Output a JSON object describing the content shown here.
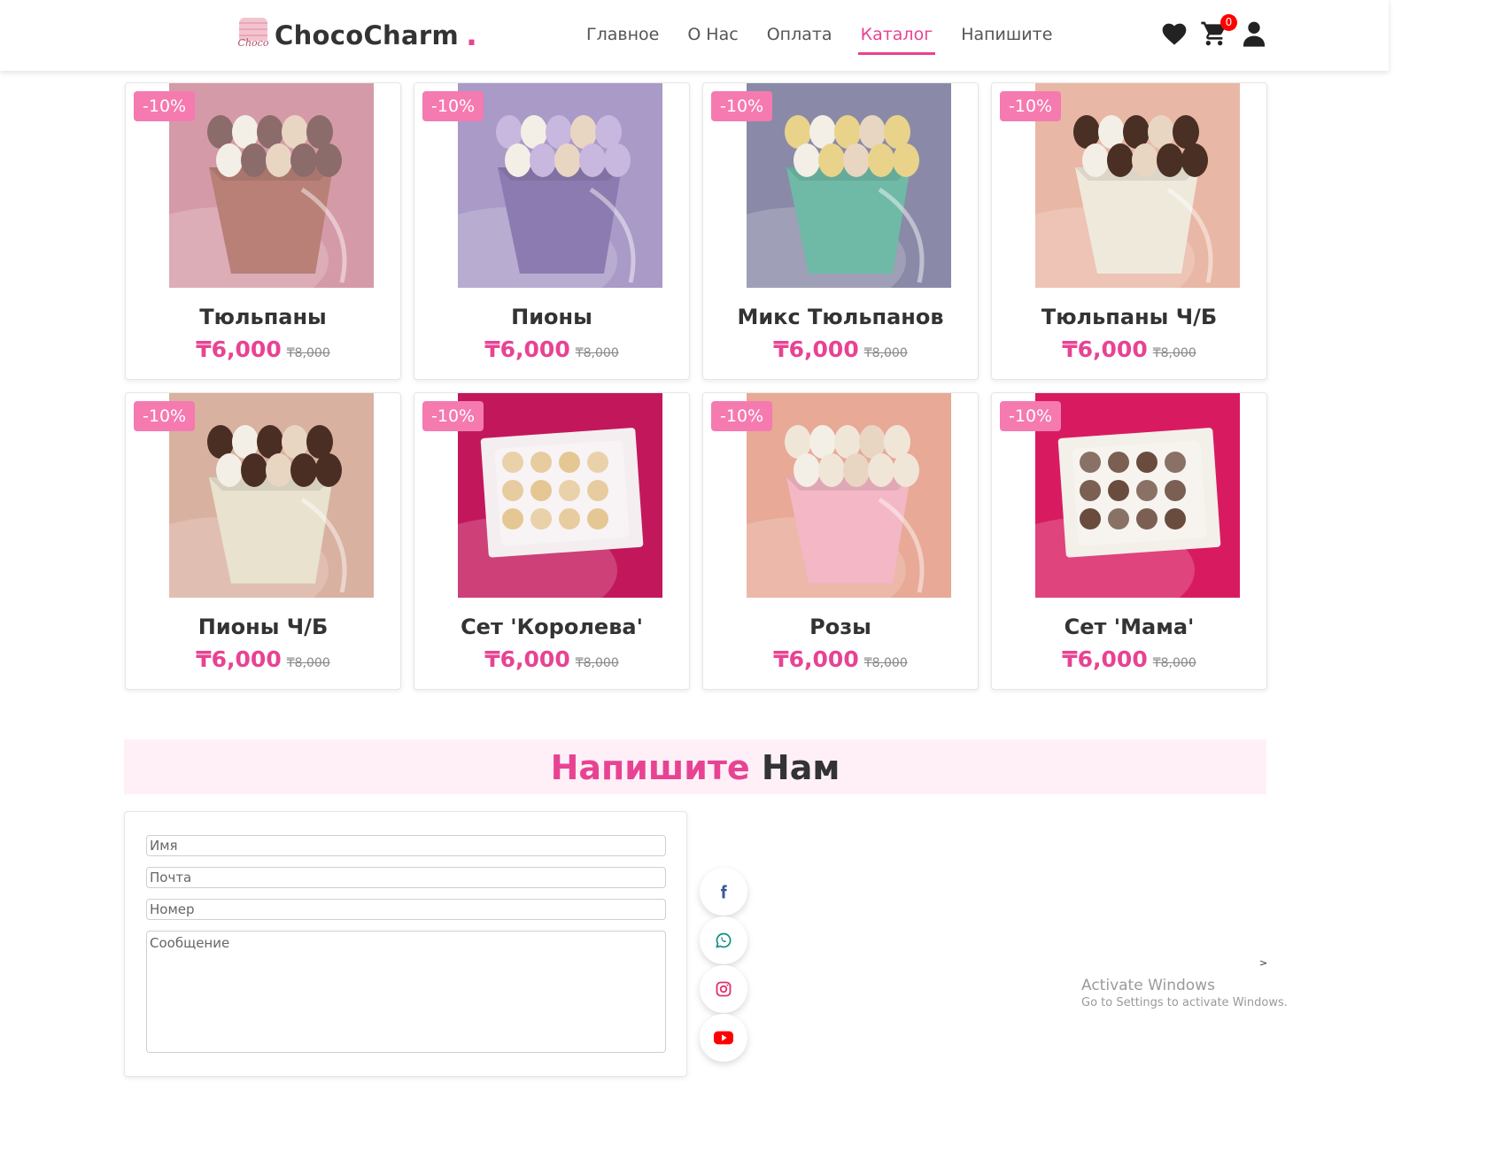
{
  "brand": {
    "name": "ChocoCharm",
    "dot": ".",
    "logo_script": "Choco",
    "accent": "#e84393"
  },
  "nav": [
    {
      "label": "Главное",
      "active": false
    },
    {
      "label": "О Нас",
      "active": false
    },
    {
      "label": "Оплата",
      "active": false
    },
    {
      "label": "Каталог",
      "active": true
    },
    {
      "label": "Напишите",
      "active": false
    }
  ],
  "header_icons": {
    "wishlist": "heart-icon",
    "cart": "cart-icon",
    "cart_count": "0",
    "account": "user-icon"
  },
  "products": [
    {
      "name": "Тюльпаны",
      "discount": "-10%",
      "price": "₸6,000",
      "old_price": "₸8,000",
      "palette": [
        "#d59aa8",
        "#b88077",
        "#8c6b6b"
      ]
    },
    {
      "name": "Пионы",
      "discount": "-10%",
      "price": "₸6,000",
      "old_price": "₸8,000",
      "palette": [
        "#a99ac7",
        "#8c7bb0",
        "#c8b8e0"
      ]
    },
    {
      "name": "Микс Тюльпанов",
      "discount": "-10%",
      "price": "₸6,000",
      "old_price": "₸8,000",
      "palette": [
        "#8a8aa8",
        "#6fb9a7",
        "#e9d38a"
      ]
    },
    {
      "name": "Тюльпаны Ч/Б",
      "discount": "-10%",
      "price": "₸6,000",
      "old_price": "₸8,000",
      "palette": [
        "#e9b7a5",
        "#efe9dc",
        "#4a2f25"
      ]
    },
    {
      "name": "Пионы Ч/Б",
      "discount": "-10%",
      "price": "₸6,000",
      "old_price": "₸8,000",
      "palette": [
        "#d9b1a1",
        "#e8e2cf",
        "#4b2e23"
      ]
    },
    {
      "name": "Сет 'Королева'",
      "discount": "-10%",
      "price": "₸6,000",
      "old_price": "₸8,000",
      "palette": [
        "#c2185b",
        "#f4eef0",
        "#e2c28a"
      ]
    },
    {
      "name": "Розы",
      "discount": "-10%",
      "price": "₸6,000",
      "old_price": "₸8,000",
      "palette": [
        "#e8a996",
        "#f3b7c5",
        "#f0e6d8"
      ]
    },
    {
      "name": "Сет 'Мама'",
      "discount": "-10%",
      "price": "₸6,000",
      "old_price": "₸8,000",
      "palette": [
        "#d81b60",
        "#f3efe9",
        "#5a3a2a"
      ]
    }
  ],
  "contact": {
    "heading_accent": "Напишите",
    "heading_rest": "Нам",
    "name_placeholder": "Имя",
    "email_placeholder": "Почта",
    "phone_placeholder": "Номер",
    "message_placeholder": "Сообщение"
  },
  "social": [
    {
      "icon": "facebook-icon",
      "color": "#3b5998"
    },
    {
      "icon": "whatsapp-icon",
      "color": "#128c7e"
    },
    {
      "icon": "instagram-icon",
      "color": "#e1306c"
    },
    {
      "icon": "youtube-icon",
      "color": "#ff0000"
    }
  ],
  "watermark": {
    "title": "Activate Windows",
    "subtitle": "Go to Settings to activate Windows.",
    "arrow": ">"
  }
}
